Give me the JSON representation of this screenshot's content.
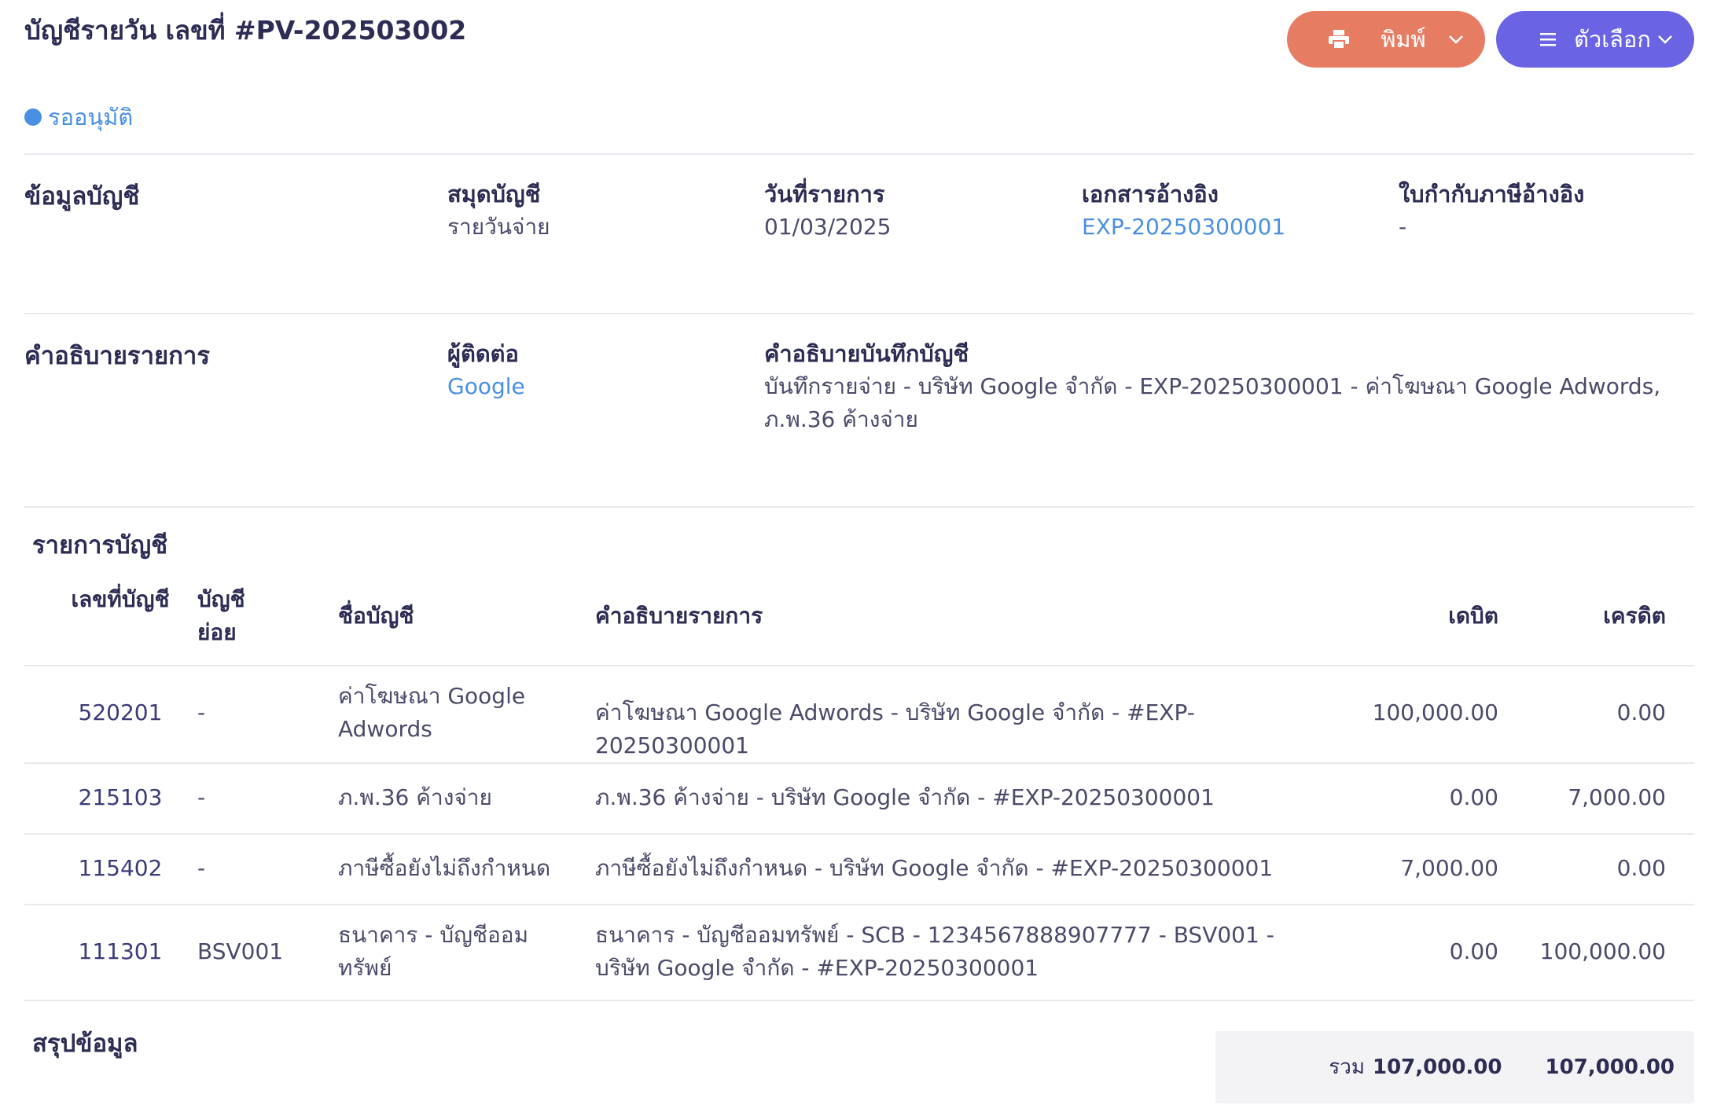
{
  "header": {
    "title": "บัญชีรายวัน เลขที่ #PV-202503002",
    "print_label": "พิมพ์",
    "options_label": "ตัวเลือก"
  },
  "status": {
    "label": "รออนุมัติ",
    "color": "#4a90e2"
  },
  "account_info": {
    "section_title": "ข้อมูลบัญชี",
    "book_label": "สมุดบัญชี",
    "book_value": "รายวันจ่าย",
    "date_label": "วันที่รายการ",
    "date_value": "01/03/2025",
    "ref_doc_label": "เอกสารอ้างอิง",
    "ref_doc_value": "EXP-20250300001",
    "tax_invoice_label": "ใบกำกับภาษีอ้างอิง",
    "tax_invoice_value": "-"
  },
  "description": {
    "section_title": "คำอธิบายรายการ",
    "contact_label": "ผู้ติดต่อ",
    "contact_value": "Google",
    "memo_label": "คำอธิบายบันทึกบัญชี",
    "memo_value": "บันทึกรายจ่าย - บริษัท Google จำกัด - EXP-20250300001 - ค่าโฆษณา Google Adwords, ภ.พ.36 ค้างจ่าย"
  },
  "entries": {
    "title": "รายการบัญชี",
    "columns": {
      "account_no": "เลขที่บัญชี",
      "sub_account": "บัญชีย่อย",
      "account_name": "ชื่อบัญชี",
      "description": "คำอธิบายรายการ",
      "debit": "เดบิต",
      "credit": "เครดิต"
    },
    "rows": [
      {
        "account_no": "520201",
        "sub_account": "-",
        "account_name": "ค่าโฆษณา Google Adwords",
        "description": "ค่าโฆษณา Google Adwords - บริษัท Google จำกัด - #EXP-20250300001",
        "debit": "100,000.00",
        "credit": "0.00"
      },
      {
        "account_no": "215103",
        "sub_account": "-",
        "account_name": "ภ.พ.36 ค้างจ่าย",
        "description": "ภ.พ.36 ค้างจ่าย - บริษัท Google จำกัด - #EXP-20250300001",
        "debit": "0.00",
        "credit": "7,000.00"
      },
      {
        "account_no": "115402",
        "sub_account": "-",
        "account_name": "ภาษีซื้อยังไม่ถึงกำหนด",
        "description": "ภาษีซื้อยังไม่ถึงกำหนด - บริษัท Google จำกัด - #EXP-20250300001",
        "debit": "7,000.00",
        "credit": "0.00"
      },
      {
        "account_no": "111301",
        "sub_account": "BSV001",
        "account_name": "ธนาคาร - บัญชีออมทรัพย์",
        "description": "ธนาคาร - บัญชีออมทรัพย์ - SCB - 1234567888907777 - BSV001 - บริษัท Google จำกัด - #EXP-20250300001",
        "debit": "0.00",
        "credit": "100,000.00"
      }
    ]
  },
  "summary": {
    "title": "สรุปข้อมูล",
    "total_label": "รวม",
    "total_debit": "107,000.00",
    "total_credit": "107,000.00"
  }
}
